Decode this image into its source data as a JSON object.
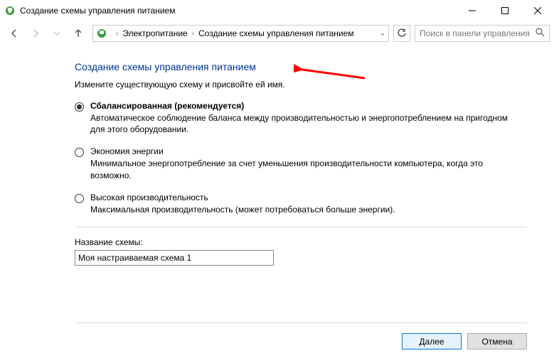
{
  "window": {
    "title": "Создание схемы управления питанием"
  },
  "breadcrumb": {
    "item1": "Электропитание",
    "item2": "Создание схемы управления питанием"
  },
  "search": {
    "placeholder": "Поиск в панели управления"
  },
  "page": {
    "heading": "Создание схемы управления питанием",
    "subtitle": "Измените существующую схему и присвойте ей имя."
  },
  "options": [
    {
      "title": "Сбалансированная (рекомендуется)",
      "desc": "Автоматическое соблюдение баланса между производительностью и энергопотреблением на пригодном для этого оборудовании."
    },
    {
      "title": "Экономия энергии",
      "desc": "Минимальное энергопотребление за счет уменьшения производительности компьютера, когда это возможно."
    },
    {
      "title": "Высокая производительность",
      "desc": "Максимальная производительность (может потребоваться больше энергии)."
    }
  ],
  "field": {
    "label": "Название схемы:",
    "value": "Моя настраиваемая схема 1"
  },
  "buttons": {
    "next": "Далее",
    "cancel": "Отмена"
  }
}
